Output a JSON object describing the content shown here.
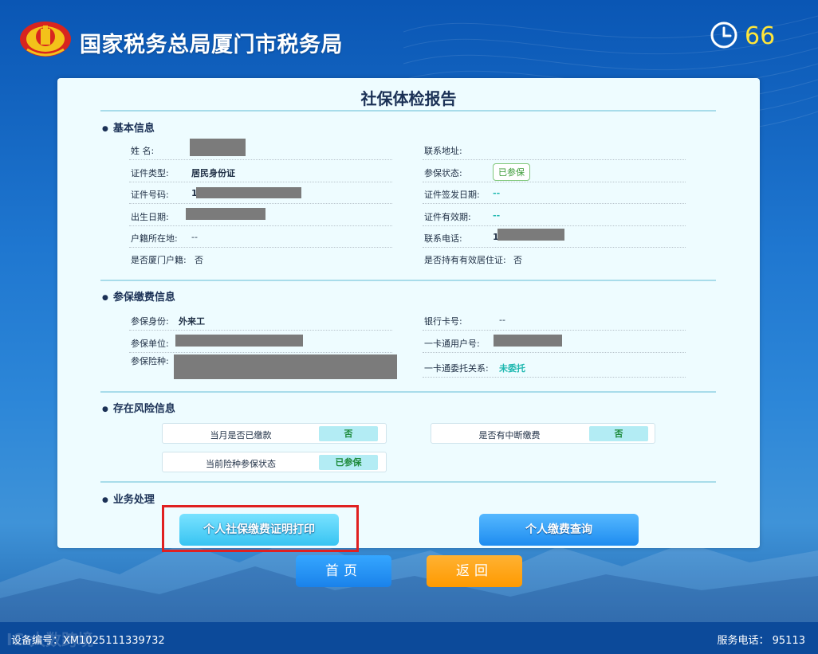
{
  "header": {
    "title": "国家税务总局厦门市税务局",
    "countdown": "66"
  },
  "report": {
    "title": "社保体检报告",
    "basic": {
      "section_title": "基本信息",
      "name_label": "姓 名:",
      "id_type_label": "证件类型:",
      "id_type_value": "居民身份证",
      "id_no_label": "证件号码:",
      "id_no_prefix": "1",
      "birth_label": "出生日期:",
      "household_label": "户籍所在地:",
      "household_value": "--",
      "xiamen_hukou_label": "是否厦门户籍:",
      "xiamen_hukou_value": "否",
      "address_label": "联系地址:",
      "insured_status_label": "参保状态:",
      "insured_status_value": "已参保",
      "id_issue_label": "证件签发日期:",
      "id_issue_value": "--",
      "id_valid_label": "证件有效期:",
      "id_valid_value": "--",
      "phone_label": "联系电话:",
      "phone_prefix": "1",
      "residence_permit_label": "是否持有有效居住证:",
      "residence_permit_value": "否"
    },
    "payment": {
      "section_title": "参保缴费信息",
      "identity_label": "参保身份:",
      "identity_value": "外来工",
      "unit_label": "参保单位:",
      "types_label": "参保险种:",
      "bank_label": "银行卡号:",
      "bank_value": "--",
      "card_account_label": "一卡通用户号:",
      "entrust_label": "一卡通委托关系:",
      "entrust_value": "未委托"
    },
    "risk": {
      "section_title": "存在风险信息",
      "paid_label": "当月是否已缴款",
      "paid_value": "否",
      "interrupt_label": "是否有中断缴费",
      "interrupt_value": "否",
      "current_status_label": "当前险种参保状态",
      "current_status_value": "已参保"
    },
    "business": {
      "section_title": "业务处理",
      "print_button": "个人社保缴费证明打印",
      "query_button": "个人缴费查询"
    }
  },
  "nav": {
    "home": "首页",
    "back": "返回"
  },
  "footer": {
    "device_no": "设备编号：XM1025111339732",
    "service_phone": "服务电话： 95113",
    "watermark": "IC 大数跨境"
  },
  "colors": {
    "accent_cyan": "#1fb8b0",
    "highlight": "#e02020",
    "countdown": "#ffe63a"
  }
}
